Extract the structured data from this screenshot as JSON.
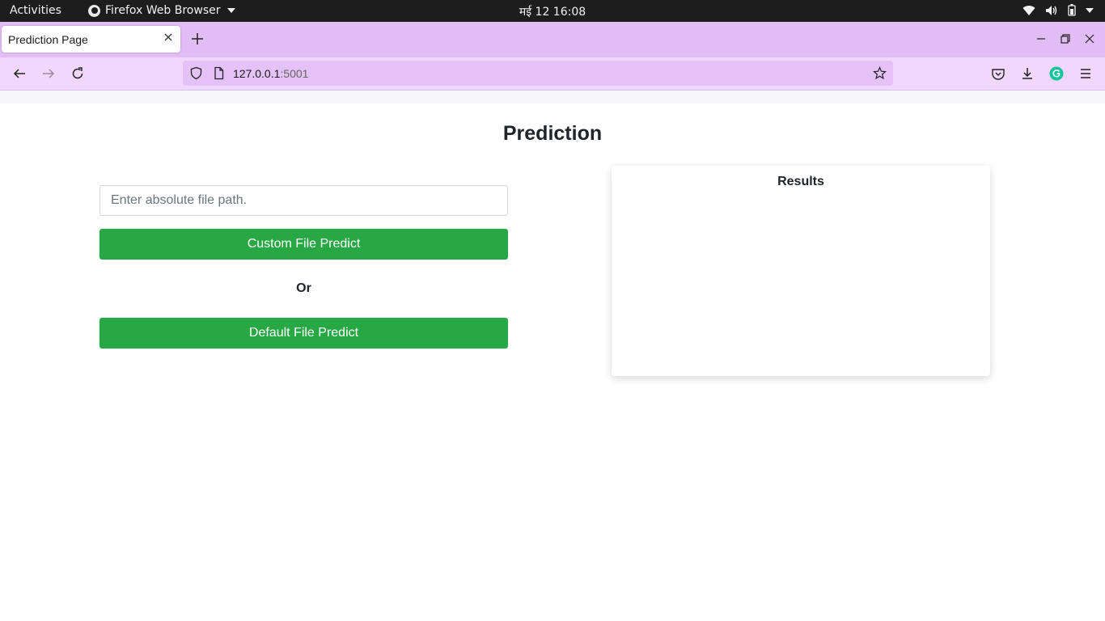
{
  "system_bar": {
    "activities_label": "Activities",
    "app_name": "Firefox Web Browser",
    "clock": "मई 12  16:08",
    "icons": [
      "wifi-icon",
      "volume-icon",
      "battery-icon",
      "power-menu-caret-icon"
    ]
  },
  "browser": {
    "tab_title": "Prediction Page",
    "url_host": "127.0.0.1",
    "url_port": ":5001",
    "colors": {
      "tabstrip": "#e2bdf5",
      "navbar": "#f0d7fb",
      "urlbar": "#e4c1f7",
      "grammarly": "#15c39a"
    }
  },
  "page": {
    "title": "Prediction",
    "path_placeholder": "Enter absolute file path.",
    "custom_button_label": "Custom File Predict",
    "or_label": "Or",
    "default_button_label": "Default File Predict",
    "results_title": "Results",
    "button_color": "#28a745"
  }
}
